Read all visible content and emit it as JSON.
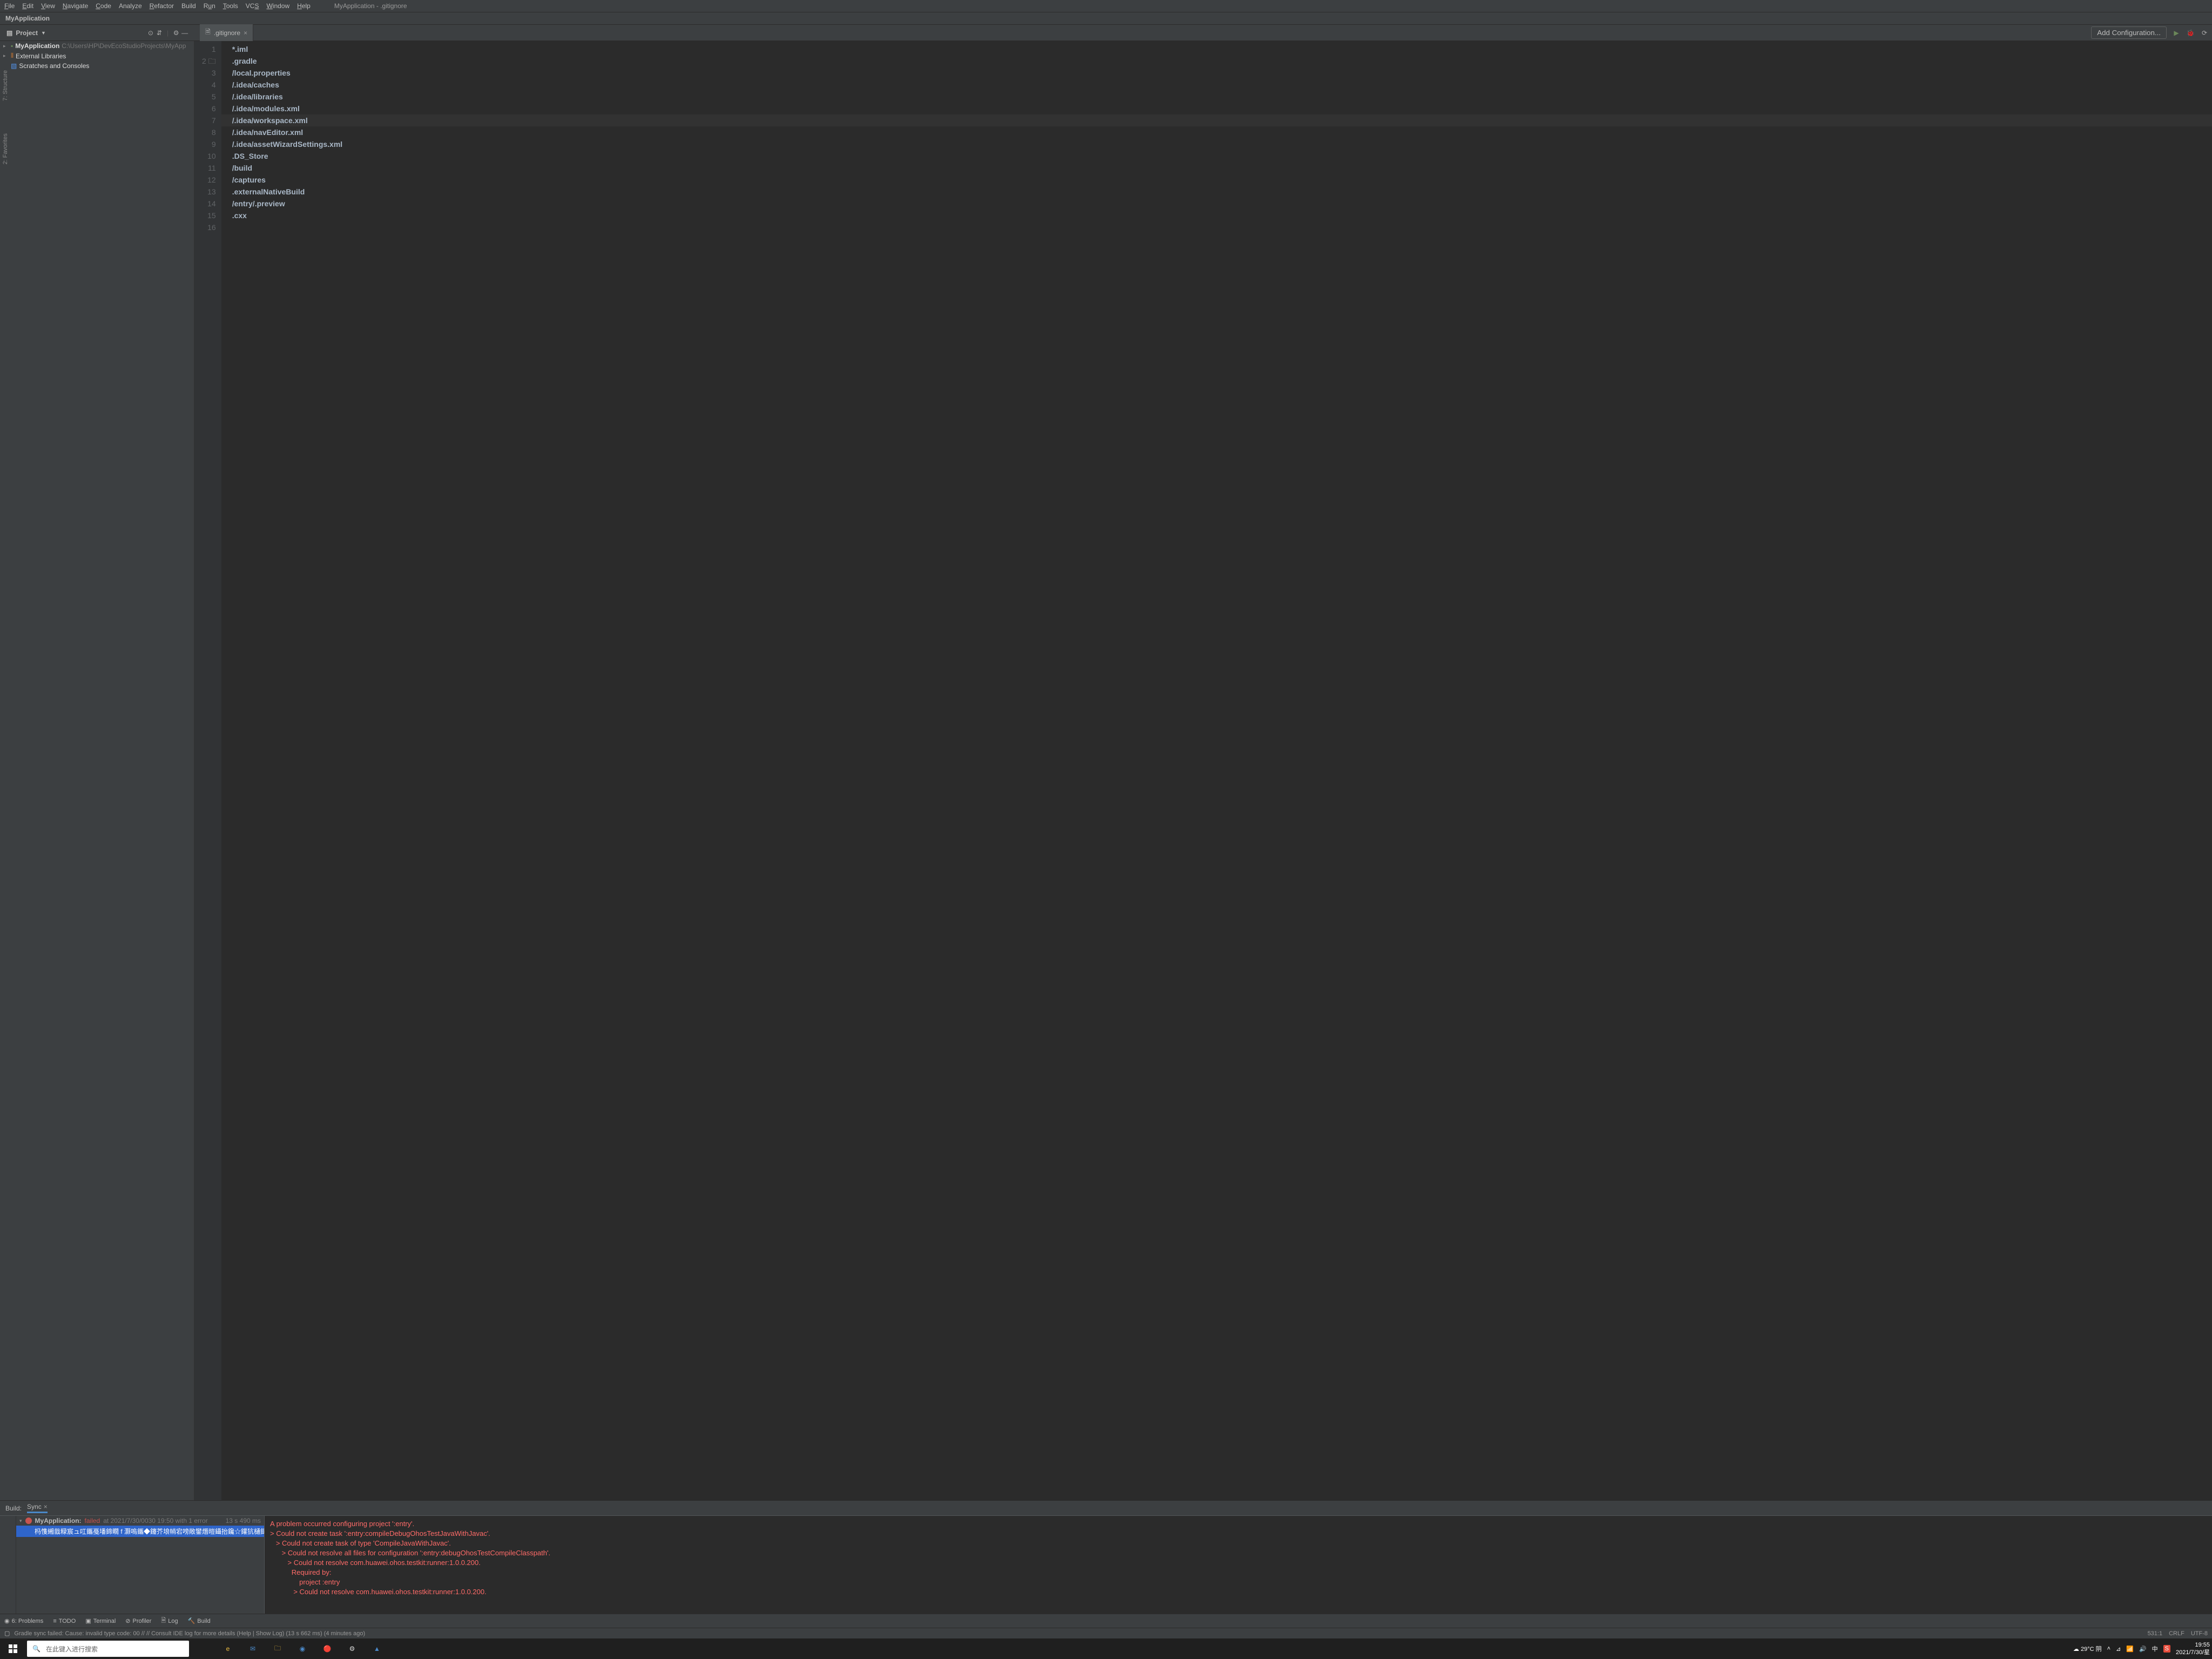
{
  "menu": {
    "file": "File",
    "edit": "Edit",
    "view": "View",
    "navigate": "Navigate",
    "code": "Code",
    "analyze": "Analyze",
    "refactor": "Refactor",
    "build": "Build",
    "run": "Run",
    "tools": "Tools",
    "vcs": "VCS",
    "window": "Window",
    "help": "Help"
  },
  "breadcrumb": {
    "app": "MyApplication",
    "path": "MyApplication - .gitignore"
  },
  "project_dropdown": "Project",
  "config_button": "Add Configuration...",
  "editor_tab": {
    "name": ".gitignore"
  },
  "tree": {
    "root": {
      "name": "MyApplication",
      "hint": "C:\\Users\\HP\\DevEcoStudioProjects\\MyApp"
    },
    "libs": "External Libraries",
    "scratch": "Scratches and Consoles"
  },
  "code_lines": [
    "*.iml",
    ".gradle",
    "/local.properties",
    "/.idea/caches",
    "/.idea/libraries",
    "/.idea/modules.xml",
    "/.idea/workspace.xml",
    "/.idea/navEditor.xml",
    "/.idea/assetWizardSettings.xml",
    ".DS_Store",
    "/build",
    "/captures",
    ".externalNativeBuild",
    "/entry/.preview",
    ".cxx",
    ""
  ],
  "current_line_index": 6,
  "build": {
    "label": "Build:",
    "tab": "Sync",
    "task": {
      "name": "MyApplication:",
      "status": "failed",
      "at": "at 2021/7/30/0030 19:50 with 1 error",
      "dur": "13 s 490 ms"
    },
    "subtask": "杩愯緗戠粶宸ュ叿鑴戞墦鍗瞯 f 灏嗚鑴◆鑳芥埌帩宕嗙敞鐢熸暟鑷抬鑱☆鑵犺樋鍓嶆暟涓湪",
    "output": [
      "A problem occurred configuring project ':entry'.",
      "> Could not create task ':entry:compileDebugOhosTestJavaWithJavac'.",
      "   > Could not create task of type 'CompileJavaWithJavac'.",
      "      > Could not resolve all files for configuration ':entry:debugOhosTestCompileClasspath'.",
      "         > Could not resolve com.huawei.ohos.testkit:runner:1.0.0.200.",
      "           Required by:",
      "               project :entry",
      "            > Could not resolve com.huawei.ohos.testkit:runner:1.0.0.200."
    ]
  },
  "bottom_tabs": {
    "problems": "6: Problems",
    "todo": "TODO",
    "terminal": "Terminal",
    "profiler": "Profiler",
    "log": "Log",
    "build": "Build"
  },
  "status": {
    "msg": "Gradle sync failed: Cause: invalid type code: 00 // // Consult IDE log for more details (Help | Show Log) (13 s 662 ms) (4 minutes ago)",
    "pos": "531:1",
    "sep": "CRLF",
    "enc": "UTF-8"
  },
  "left_rail": {
    "structure": "7: Structure",
    "favorites": "2: Favorites"
  },
  "taskbar": {
    "search_placeholder": "在此键入进行搜索",
    "weather": "29°C 阴",
    "ime": "中",
    "time": "19:55",
    "date": "2021/7/30/星"
  }
}
